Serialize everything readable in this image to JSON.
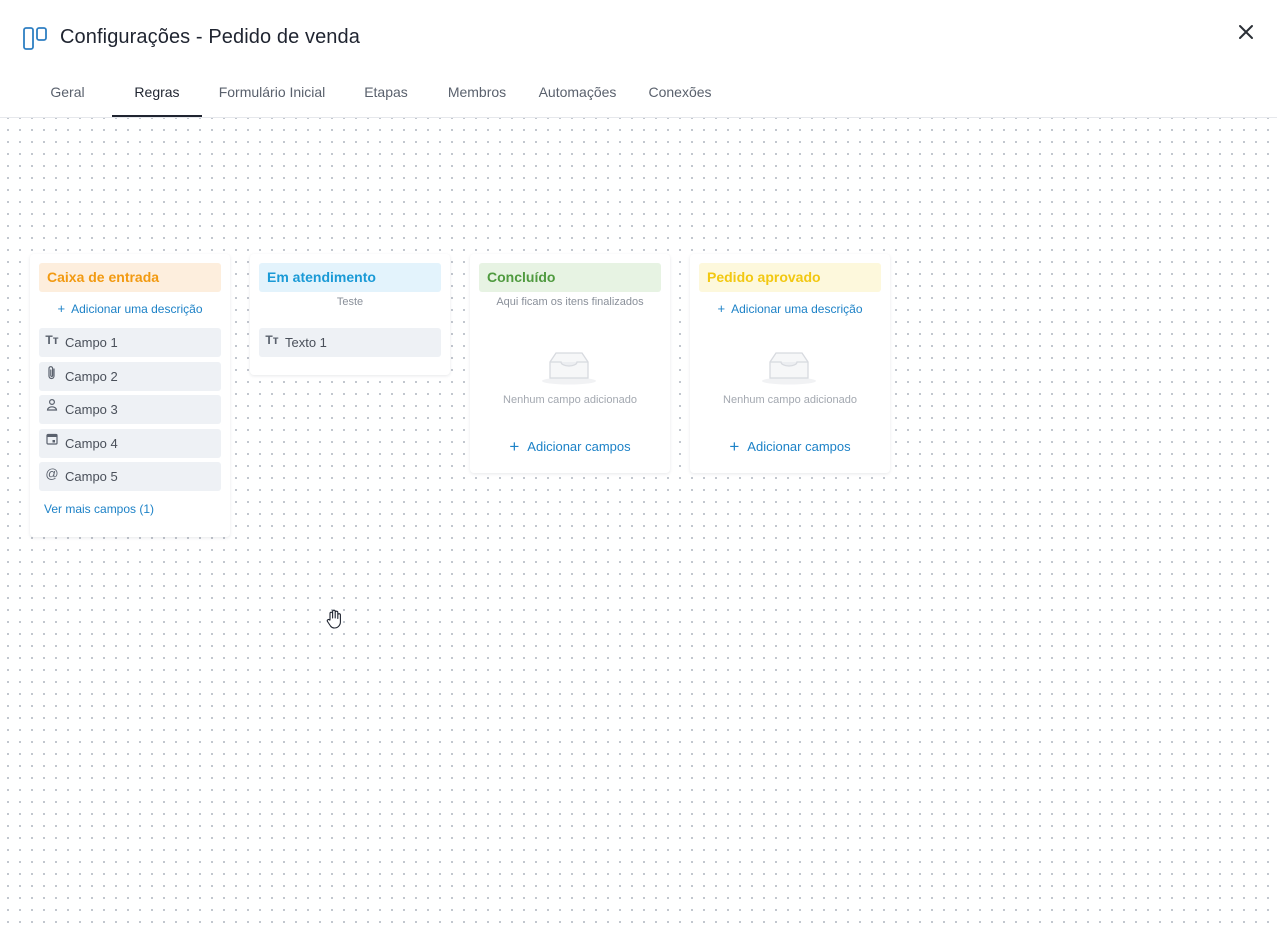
{
  "header": {
    "title": "Configurações - Pedido de venda",
    "icon": "board-icon",
    "close_icon": "close-icon"
  },
  "tabs": [
    {
      "label": "Geral"
    },
    {
      "label": "Regras",
      "active": true
    },
    {
      "label": "Formulário Inicial"
    },
    {
      "label": "Etapas"
    },
    {
      "label": "Membros"
    },
    {
      "label": "Automações"
    },
    {
      "label": "Conexões"
    }
  ],
  "stages": [
    {
      "title": "Caixa de entrada",
      "color": "#f29a11",
      "bg": "#fdeedd",
      "add_description": "Adicionar uma descrição",
      "fields": [
        {
          "label": "Campo 1",
          "icon": "text-icon"
        },
        {
          "label": "Campo 2",
          "icon": "attachment-icon"
        },
        {
          "label": "Campo 3",
          "icon": "user-icon"
        },
        {
          "label": "Campo 4",
          "icon": "calendar-icon"
        },
        {
          "label": "Campo 5",
          "icon": "at-icon"
        }
      ],
      "more_fields": "Ver mais campos (1)"
    },
    {
      "title": "Em atendimento",
      "color": "#1a9ad6",
      "bg": "#e3f3fc",
      "description": "Teste",
      "fields": [
        {
          "label": "Texto 1",
          "icon": "text-icon"
        }
      ]
    },
    {
      "title": "Concluído",
      "color": "#4f9a3f",
      "bg": "#e7f3e3",
      "description": "Aqui ficam os itens finalizados",
      "empty_text": "Nenhum campo adicionado",
      "add_fields": "Adicionar campos"
    },
    {
      "title": "Pedido aprovado",
      "color": "#f2c811",
      "bg": "#fdf8dc",
      "add_description": "Adicionar uma descrição",
      "empty_text": "Nenhum campo adicionado",
      "add_fields": "Adicionar campos"
    }
  ],
  "colors": {
    "accent": "#1d82c7",
    "tab_active_underline": "#1f2430"
  }
}
